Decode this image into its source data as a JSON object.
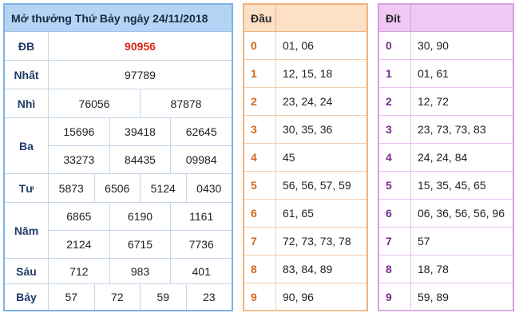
{
  "title": "Mở thưởng Thứ Bảy ngày 24/11/2018",
  "prizes": {
    "db": {
      "label": "ĐB",
      "values": [
        "90956"
      ]
    },
    "nhat": {
      "label": "Nhất",
      "values": [
        "97789"
      ]
    },
    "nhi": {
      "label": "Nhì",
      "values": [
        "76056",
        "87878"
      ]
    },
    "ba": {
      "label": "Ba",
      "values": [
        "15696",
        "39418",
        "62645",
        "33273",
        "84435",
        "09984"
      ]
    },
    "tu": {
      "label": "Tư",
      "values": [
        "5873",
        "6506",
        "5124",
        "0430"
      ]
    },
    "nam": {
      "label": "Năm",
      "values": [
        "6865",
        "6190",
        "1161",
        "2124",
        "6715",
        "7736"
      ]
    },
    "sau": {
      "label": "Sáu",
      "values": [
        "712",
        "983",
        "401"
      ]
    },
    "bay": {
      "label": "Bảy",
      "values": [
        "57",
        "72",
        "59",
        "23"
      ]
    }
  },
  "dau": {
    "header": "Đầu",
    "rows": [
      {
        "k": "0",
        "v": "01, 06"
      },
      {
        "k": "1",
        "v": "12, 15, 18"
      },
      {
        "k": "2",
        "v": "23, 24, 24"
      },
      {
        "k": "3",
        "v": "30, 35, 36"
      },
      {
        "k": "4",
        "v": "45"
      },
      {
        "k": "5",
        "v": "56, 56, 57, 59"
      },
      {
        "k": "6",
        "v": "61, 65"
      },
      {
        "k": "7",
        "v": "72, 73, 73, 78"
      },
      {
        "k": "8",
        "v": "83, 84, 89"
      },
      {
        "k": "9",
        "v": "90, 96"
      }
    ]
  },
  "dit": {
    "header": "Đít",
    "rows": [
      {
        "k": "0",
        "v": "30, 90"
      },
      {
        "k": "1",
        "v": "01, 61"
      },
      {
        "k": "2",
        "v": "12, 72"
      },
      {
        "k": "3",
        "v": "23, 73, 73, 83"
      },
      {
        "k": "4",
        "v": "24, 24, 84"
      },
      {
        "k": "5",
        "v": "15, 35, 45, 65"
      },
      {
        "k": "6",
        "v": "06, 36, 56, 56, 96"
      },
      {
        "k": "7",
        "v": "57"
      },
      {
        "k": "8",
        "v": "18, 78"
      },
      {
        "k": "9",
        "v": "59, 89"
      }
    ]
  },
  "colors": {
    "special_prize": "#e0241b",
    "results_header": "#b3d4f5",
    "dau_header": "#fde1c6",
    "dit_header": "#efc8f3"
  }
}
